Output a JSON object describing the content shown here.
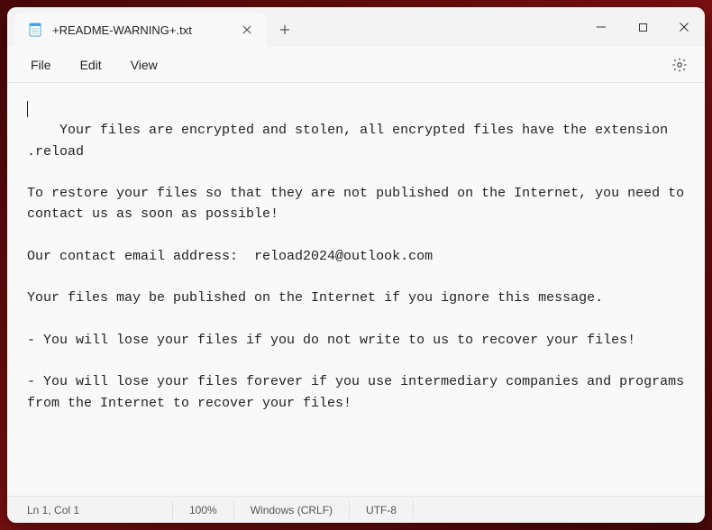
{
  "tab": {
    "title": "+README-WARNING+.txt"
  },
  "menu": {
    "file": "File",
    "edit": "Edit",
    "view": "View"
  },
  "document": {
    "text": "Your files are encrypted and stolen, all encrypted files have the extension .reload\n\nTo restore your files so that they are not published on the Internet, you need to contact us as soon as possible!\n\nOur contact email address:  reload2024@outlook.com\n\nYour files may be published on the Internet if you ignore this message.\n\n- You will lose your files if you do not write to us to recover your files!\n\n- You will lose your files forever if you use intermediary companies and programs from the Internet to recover your files!"
  },
  "status": {
    "position": "Ln 1, Col 1",
    "zoom": "100%",
    "line_endings": "Windows (CRLF)",
    "encoding": "UTF-8"
  }
}
